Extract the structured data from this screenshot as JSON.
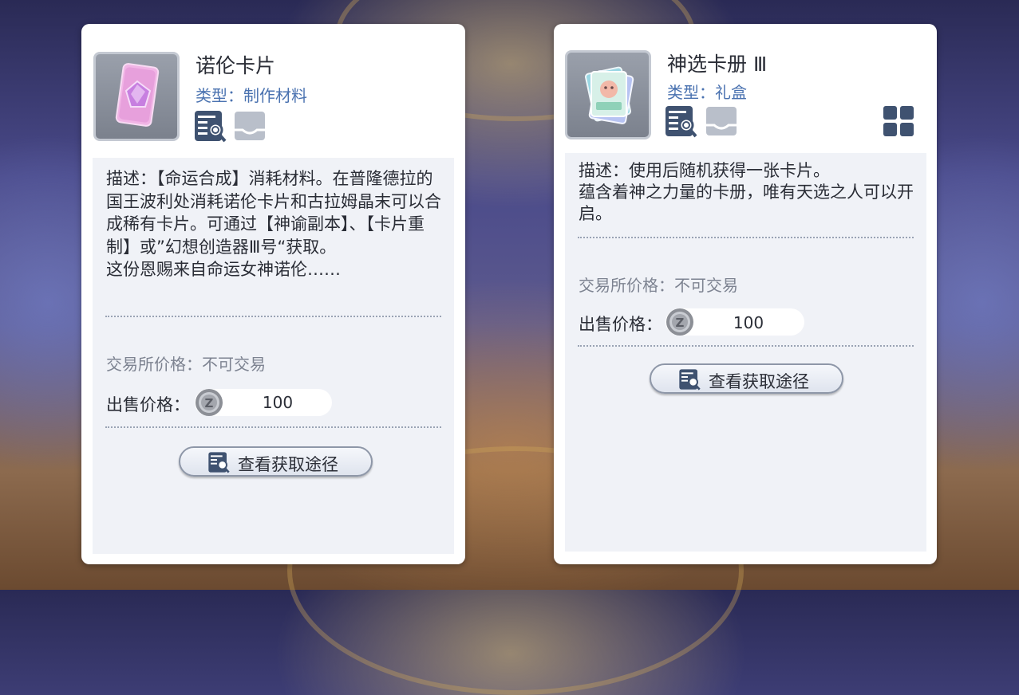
{
  "left_item": {
    "name": "诺伦卡片",
    "type_line": "类型：制作材料",
    "icon_names": [
      "quest-book-icon",
      "inbox-tray-icon"
    ],
    "description": "描述：【命运合成】消耗材料。在普隆德拉的国王波利处消耗诺伦卡片和古拉姆晶末可以合成稀有卡片。可通过【神谕副本】、【卡片重制】或”幻想创造器Ⅲ号“获取。\n这份恩赐来自命运女神诺伦……",
    "trade_text": "交易所价格：不可交易",
    "sell_label": "出售价格：",
    "sell_price": "100",
    "button_label": "查看获取途径"
  },
  "right_item": {
    "name": "神选卡册 Ⅲ",
    "type_line": "类型：礼盒",
    "icon_names": [
      "quest-book-icon",
      "inbox-tray-icon",
      "grid-icon"
    ],
    "description": "描述：使用后随机获得一张卡片。\n蕴含着神之力量的卡册，唯有天选之人可以开启。",
    "trade_text": "交易所价格：不可交易",
    "sell_label": "出售价格：",
    "sell_price": "100",
    "button_label": "查看获取途径"
  },
  "colors": {
    "type_text": "#4a72b0",
    "icon_dark": "#3f5270",
    "icon_light": "#b9bfca",
    "muted_text": "#7d8391"
  }
}
